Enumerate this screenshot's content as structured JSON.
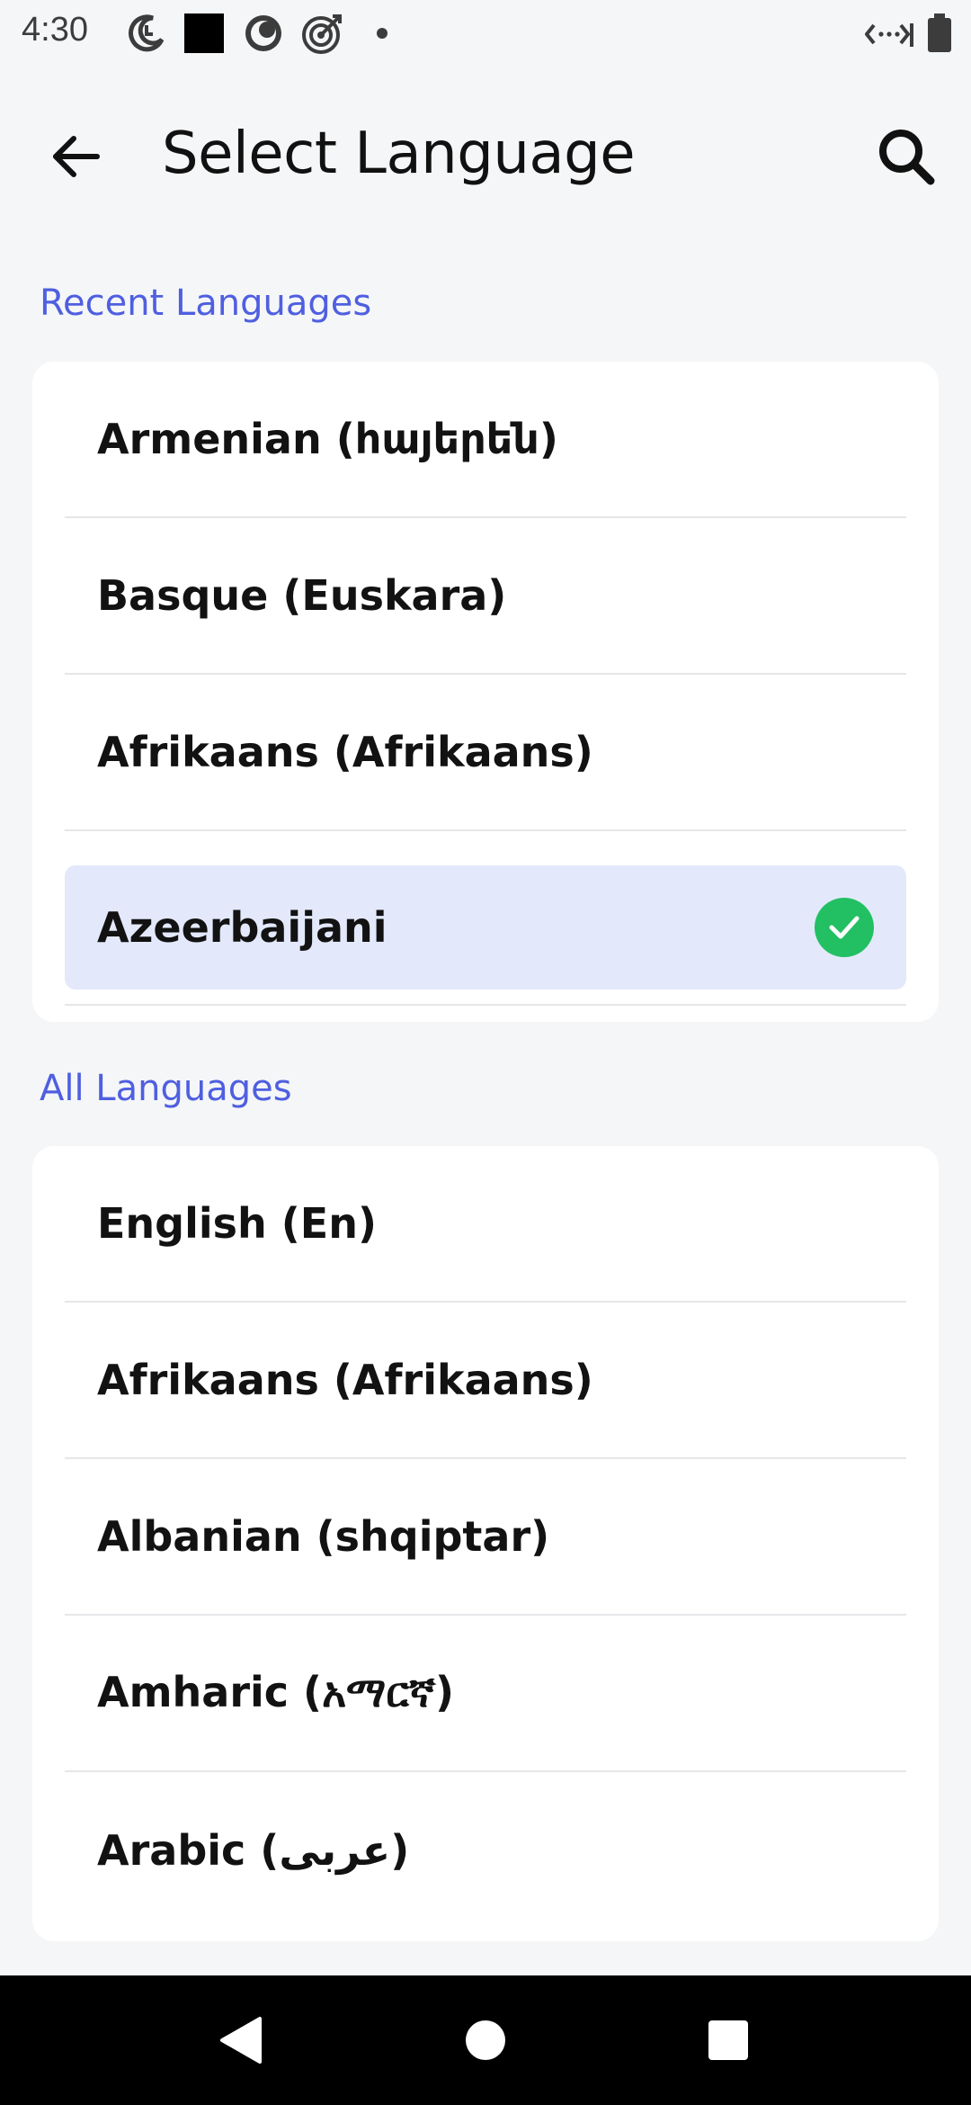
{
  "status_bar": {
    "time": "4:30",
    "icons": [
      "do-not-disturb-icon",
      "square-icon",
      "record-icon",
      "target-icon",
      "dot-icon",
      "wifi-data-icon",
      "battery-icon"
    ]
  },
  "app_bar": {
    "title": "Select Language",
    "back_icon": "arrow-left-icon",
    "search_icon": "search-icon"
  },
  "recent": {
    "header": "Recent Languages",
    "items": [
      {
        "label": "Armenian (հայերեն)"
      },
      {
        "label": "Basque (Euskara)"
      },
      {
        "label": "Afrikaans (Afrikaans)"
      },
      {
        "label": "Azeerbaijani",
        "selected": true
      }
    ]
  },
  "all": {
    "header": "All Languages",
    "items": [
      {
        "label": "English (En)"
      },
      {
        "label": "Afrikaans (Afrikaans)"
      },
      {
        "label": "Albanian (shqiptar)"
      },
      {
        "label": "Amharic (አማርኛ)"
      },
      {
        "label": "Arabic (عربى)"
      }
    ]
  },
  "colors": {
    "accent": "#4f5fe0",
    "selected_bg": "#e3e9fb",
    "check": "#22c063"
  },
  "nav_bar": {
    "icons": [
      "back-triangle-icon",
      "home-circle-icon",
      "recents-square-icon"
    ]
  }
}
